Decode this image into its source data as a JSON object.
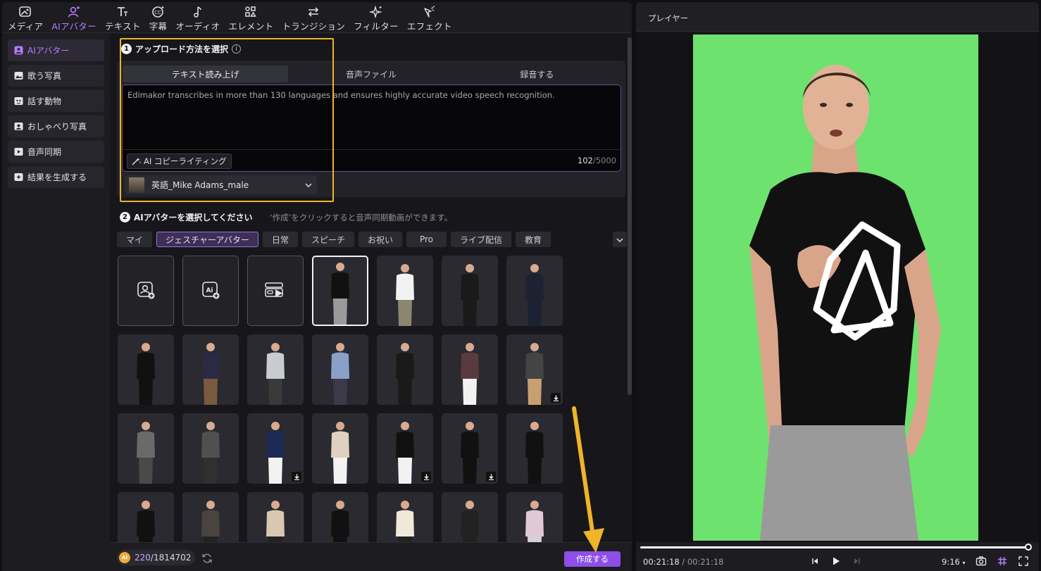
{
  "toolbar": {
    "items": [
      {
        "label": "メディア",
        "icon": "media-icon"
      },
      {
        "label": "AIアバター",
        "icon": "avatar-icon"
      },
      {
        "label": "テキスト",
        "icon": "text-icon"
      },
      {
        "label": "字幕",
        "icon": "caption-icon"
      },
      {
        "label": "オーディオ",
        "icon": "music-note-icon"
      },
      {
        "label": "エレメント",
        "icon": "element-icon"
      },
      {
        "label": "トランジション",
        "icon": "transition-icon"
      },
      {
        "label": "フィルター",
        "icon": "filter-sparkle-icon"
      },
      {
        "label": "エフェクト",
        "icon": "effect-icon"
      }
    ],
    "active_index": 1
  },
  "sidenav": {
    "items": [
      {
        "label": "AIアバター"
      },
      {
        "label": "歌う写真"
      },
      {
        "label": "話す動物"
      },
      {
        "label": "おしゃべり写真"
      },
      {
        "label": "音声同期"
      },
      {
        "label": "結果を生成する"
      }
    ]
  },
  "step1": {
    "number": "1",
    "title": "アップロード方法を選択",
    "info": "i",
    "tabs": [
      "テキスト読み上げ",
      "音声ファイル",
      "録音する"
    ],
    "text": "Edimakor transcribes in more than 130 languages and ensures highly accurate video speech recognition.",
    "copy_button": "AI コピーライティング",
    "count": "102",
    "max": "/5000",
    "voice": "英語_Mike Adams_male"
  },
  "step2": {
    "number": "2",
    "title": "AIアバターを選択してください",
    "hint": "‘作成’をクリックすると音声同期動画ができます。",
    "categories": [
      "マイ",
      "ジェスチャーアバター",
      "日常",
      "スピーチ",
      "お祝い",
      "Pro",
      "ライブ配信",
      "教育"
    ],
    "active_category": 1
  },
  "bottom": {
    "coin_label": "AI",
    "credits_used": "220",
    "credits_total": "/1814702",
    "create_label": "作成する"
  },
  "player": {
    "title": "プレイヤー",
    "current_time": "00:21:18",
    "separator": " / ",
    "duration": "00:21:18",
    "ratio": "9:16",
    "progress": 1.0
  },
  "colors": {
    "accent": "#b57cff",
    "create_button": "#8e4fe8",
    "highlight": "#f0b429",
    "greenscreen": "#6ee26e"
  }
}
